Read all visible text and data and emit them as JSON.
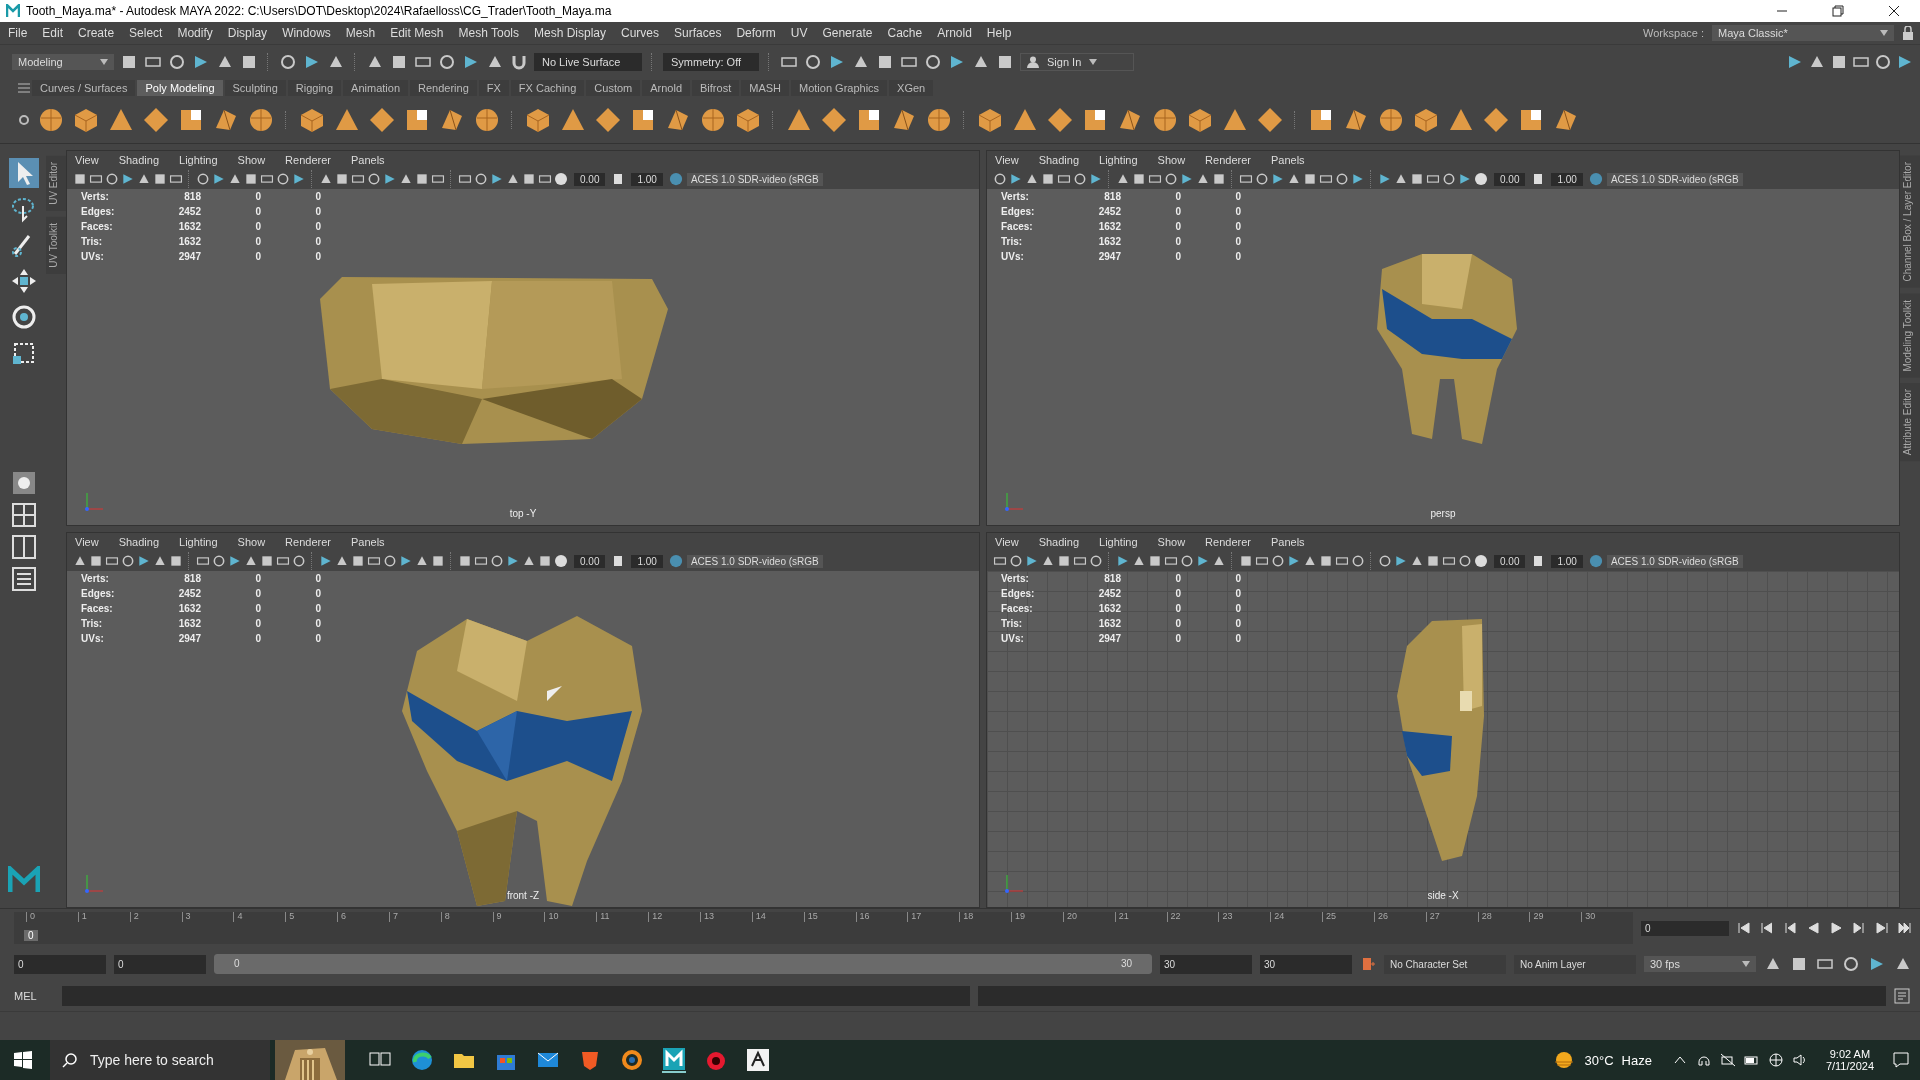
{
  "window": {
    "title": "Tooth_Maya.ma* - Autodesk MAYA 2022: C:\\Users\\DOT\\Desktop\\2024\\Rafaelloss\\CG_Trader\\Tooth_Maya.ma"
  },
  "menu_bar": [
    "File",
    "Edit",
    "Create",
    "Select",
    "Modify",
    "Display",
    "Windows",
    "Mesh",
    "Edit Mesh",
    "Mesh Tools",
    "Mesh Display",
    "Curves",
    "Surfaces",
    "Deform",
    "UV",
    "Generate",
    "Cache",
    "Arnold",
    "Help"
  ],
  "workspace": {
    "label": "Workspace :",
    "value": "Maya Classic*"
  },
  "status_line": {
    "mode": "Modeling",
    "live_surface": "No Live Surface",
    "symmetry": "Symmetry: Off",
    "sign_in": "Sign In"
  },
  "shelf_tabs": [
    {
      "label": "Curves / Surfaces",
      "selected": false
    },
    {
      "label": "Poly Modeling",
      "selected": true
    },
    {
      "label": "Sculpting",
      "selected": false
    },
    {
      "label": "Rigging",
      "selected": false
    },
    {
      "label": "Animation",
      "selected": false
    },
    {
      "label": "Rendering",
      "selected": false
    },
    {
      "label": "FX",
      "selected": false
    },
    {
      "label": "FX Caching",
      "selected": false
    },
    {
      "label": "Custom",
      "selected": false
    },
    {
      "label": "Arnold",
      "selected": false
    },
    {
      "label": "Bifrost",
      "selected": false
    },
    {
      "label": "MASH",
      "selected": false
    },
    {
      "label": "Motion Graphics",
      "selected": false
    },
    {
      "label": "XGen",
      "selected": false
    }
  ],
  "left_side_tabs": [
    "UV Editor",
    "UV Toolkit"
  ],
  "right_side_tabs": [
    "Channel Box / Layer Editor",
    "Modeling Toolkit",
    "Attribute Editor"
  ],
  "viewports": [
    {
      "kind": "top",
      "camera": "top -Y",
      "grid": false,
      "menus": [
        "View",
        "Shading",
        "Lighting",
        "Show",
        "Renderer",
        "Panels"
      ],
      "exposure": "0.00",
      "gamma": "1.00",
      "color_space": "ACES 1.0 SDR-video (sRGB",
      "stats": [
        {
          "label": "Verts:",
          "values": [
            "818",
            "0",
            "0"
          ]
        },
        {
          "label": "Edges:",
          "values": [
            "2452",
            "0",
            "0"
          ]
        },
        {
          "label": "Faces:",
          "values": [
            "1632",
            "0",
            "0"
          ]
        },
        {
          "label": "Tris:",
          "values": [
            "1632",
            "0",
            "0"
          ]
        },
        {
          "label": "UVs:",
          "values": [
            "2947",
            "0",
            "0"
          ]
        }
      ]
    },
    {
      "kind": "persp",
      "camera": "persp",
      "grid": false,
      "menus": [
        "View",
        "Shading",
        "Lighting",
        "Show",
        "Renderer",
        "Panels"
      ],
      "exposure": "0.00",
      "gamma": "1.00",
      "color_space": "ACES 1.0 SDR-video (sRGB",
      "stats": [
        {
          "label": "Verts:",
          "values": [
            "818",
            "0",
            "0"
          ]
        },
        {
          "label": "Edges:",
          "values": [
            "2452",
            "0",
            "0"
          ]
        },
        {
          "label": "Faces:",
          "values": [
            "1632",
            "0",
            "0"
          ]
        },
        {
          "label": "Tris:",
          "values": [
            "1632",
            "0",
            "0"
          ]
        },
        {
          "label": "UVs:",
          "values": [
            "2947",
            "0",
            "0"
          ]
        }
      ]
    },
    {
      "kind": "front",
      "camera": "front -Z",
      "grid": false,
      "menus": [
        "View",
        "Shading",
        "Lighting",
        "Show",
        "Renderer",
        "Panels"
      ],
      "exposure": "0.00",
      "gamma": "1.00",
      "color_space": "ACES 1.0 SDR-video (sRGB",
      "stats": [
        {
          "label": "Verts:",
          "values": [
            "818",
            "0",
            "0"
          ]
        },
        {
          "label": "Edges:",
          "values": [
            "2452",
            "0",
            "0"
          ]
        },
        {
          "label": "Faces:",
          "values": [
            "1632",
            "0",
            "0"
          ]
        },
        {
          "label": "Tris:",
          "values": [
            "1632",
            "0",
            "0"
          ]
        },
        {
          "label": "UVs:",
          "values": [
            "2947",
            "0",
            "0"
          ]
        }
      ]
    },
    {
      "kind": "side",
      "camera": "side -X",
      "grid": true,
      "menus": [
        "View",
        "Shading",
        "Lighting",
        "Show",
        "Renderer",
        "Panels"
      ],
      "exposure": "0.00",
      "gamma": "1.00",
      "color_space": "ACES 1.0 SDR-video (sRGB",
      "stats": [
        {
          "label": "Verts:",
          "values": [
            "818",
            "0",
            "0"
          ]
        },
        {
          "label": "Edges:",
          "values": [
            "2452",
            "0",
            "0"
          ]
        },
        {
          "label": "Faces:",
          "values": [
            "1632",
            "0",
            "0"
          ]
        },
        {
          "label": "Tris:",
          "values": [
            "1632",
            "0",
            "0"
          ]
        },
        {
          "label": "UVs:",
          "values": [
            "2947",
            "0",
            "0"
          ]
        }
      ]
    }
  ],
  "timeline": {
    "ticks": [
      "0",
      "1",
      "2",
      "3",
      "4",
      "5",
      "6",
      "7",
      "8",
      "9",
      "10",
      "11",
      "12",
      "13",
      "14",
      "15",
      "16",
      "17",
      "18",
      "19",
      "20",
      "21",
      "22",
      "23",
      "24",
      "25",
      "26",
      "27",
      "28",
      "29",
      "30"
    ],
    "current": "0",
    "level": 0,
    "current_frame": "0"
  },
  "range": {
    "start": "0",
    "playback_start": "0",
    "slider_start": "0",
    "slider_end": "30",
    "level": 1,
    "playback_end": "30",
    "end": "30",
    "character_set": "No Character Set",
    "anim_layer": "No Anim Layer",
    "fps": "30 fps"
  },
  "command_line": {
    "label": "MEL"
  },
  "taskbar": {
    "search_placeholder": "Type here to search",
    "temperature": "30°C",
    "condition": "Haze",
    "time": "9:02 AM",
    "date": "7/11/2024"
  }
}
